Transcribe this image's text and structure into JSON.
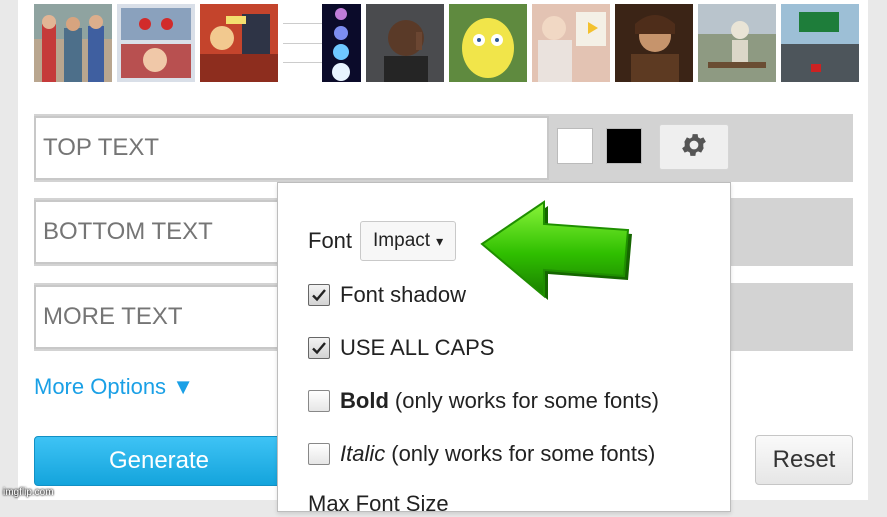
{
  "templates": [
    {
      "name": "distracted-boyfriend-thumb"
    },
    {
      "name": "two-buttons-thumb"
    },
    {
      "name": "batman-slapping-robin-thumb"
    },
    {
      "name": "expanding-brain-thumb"
    },
    {
      "name": "roll-safe-thumb"
    },
    {
      "name": "mocking-spongebob-thumb"
    },
    {
      "name": "is-this-a-pigeon-thumb"
    },
    {
      "name": "one-does-not-simply-thumb"
    },
    {
      "name": "waiting-skeleton-thumb"
    },
    {
      "name": "left-exit-12-off-ramp-thumb"
    }
  ],
  "inputs": {
    "top_placeholder": "TOP TEXT",
    "bottom_placeholder": "BOTTOM TEXT",
    "more_placeholder": "MORE TEXT"
  },
  "colors": {
    "text_color": "#ffffff",
    "outline_color": "#000000",
    "accent": "#1aa0e6",
    "arrow": "#2fbf00"
  },
  "icons": {
    "settings": "gear-icon",
    "pointer": "green-arrow-icon"
  },
  "more_options": {
    "label": "More Options",
    "arrow": "▼"
  },
  "buttons": {
    "generate": "Generate",
    "reset": "Reset"
  },
  "font_popup": {
    "font_label": "Font",
    "font_value": "Impact",
    "font_caret": "▾",
    "options": [
      {
        "label": "Font shadow",
        "checked": true
      },
      {
        "label": "USE ALL CAPS",
        "checked": true
      }
    ],
    "bold": {
      "label": "Bold",
      "note": "(only works for some fonts)",
      "checked": false
    },
    "italic": {
      "label": "Italic",
      "note": "(only works for some fonts)",
      "checked": false
    },
    "truncated_label": "Max Font Size"
  },
  "watermark": "imgflip.com"
}
